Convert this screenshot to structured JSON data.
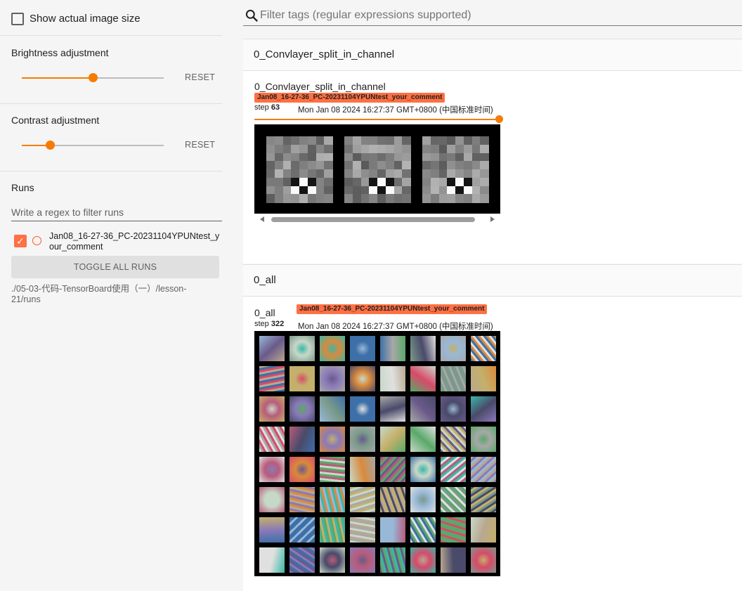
{
  "sidebar": {
    "show_actual_size_label": "Show actual image size",
    "brightness": {
      "title": "Brightness adjustment",
      "reset_label": "RESET",
      "value": 0.5
    },
    "contrast": {
      "title": "Contrast adjustment",
      "reset_label": "RESET",
      "value": 0.2
    },
    "runs": {
      "title": "Runs",
      "filter_placeholder": "Write a regex to filter runs",
      "items": [
        {
          "name": "Jan08_16-27-36_PC-20231104YPUNtest_your_comment",
          "checked": true,
          "color": "#ff7043"
        }
      ],
      "toggle_label": "TOGGLE ALL RUNS",
      "logdir": "./05-03-代码-TensorBoard使用（一）/lesson-21/runs"
    }
  },
  "main": {
    "search_placeholder": "Filter tags (regular expressions supported)",
    "groups": [
      {
        "name": "0_Convlayer_split_in_channel",
        "card": {
          "title": "0_Convlayer_split_in_channel",
          "run": "Jan08_16-27-36_PC-20231104YPUNtest_your_comment",
          "step_prefix": "step",
          "step": "63",
          "timestamp": "Mon Jan 08 2024 16:27:37 GMT+0800 (中国标准时间)",
          "step_position": 1.0
        }
      },
      {
        "name": "0_all",
        "card": {
          "title": "0_all",
          "run": "Jan08_16-27-36_PC-20231104YPUNtest_your_comment",
          "step_prefix": "step",
          "step": "322",
          "timestamp": "Mon Jan 08 2024 16:27:37 GMT+0800 (中国标准时间)"
        }
      }
    ]
  },
  "colors": {
    "accent": "#f57c00",
    "run_chip": "#ff7043"
  }
}
